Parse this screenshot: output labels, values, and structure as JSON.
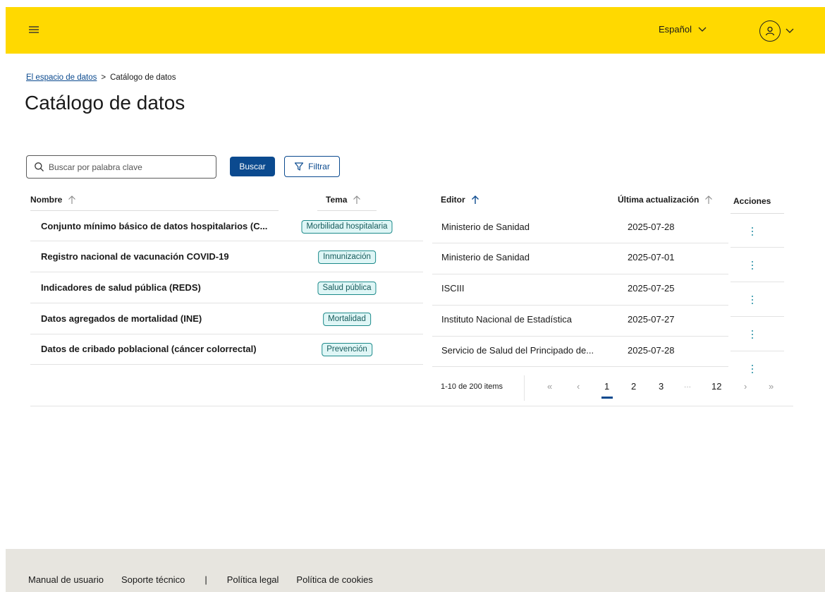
{
  "header": {
    "language": "Español",
    "menu_icon": "hamburger-menu-icon",
    "user_icon": "user-avatar-icon",
    "accent_color": "#ffd900"
  },
  "breadcrumb": {
    "parent": "El espacio de datos",
    "separator": ">",
    "current": "Catálogo de datos"
  },
  "page_title": "Catálogo de datos",
  "toolbar": {
    "search_placeholder": "Buscar por palabra clave",
    "search_button": "Buscar",
    "filter_button": "Filtrar",
    "primary_color": "#0b4a8f"
  },
  "table": {
    "columns": {
      "name": "Nombre",
      "theme": "Tema",
      "editor": "Editor",
      "updated": "Última actualización",
      "actions": "Acciones"
    },
    "rows": [
      {
        "name": "Conjunto mínimo básico de datos hospitalarios (C...",
        "theme": "Morbilidad hospitalaria",
        "editor": "Ministerio de Sanidad",
        "updated": "2025-07-28"
      },
      {
        "name": "Registro nacional de vacunación COVID-19",
        "theme": "Inmunización",
        "editor": "Ministerio de Sanidad",
        "updated": "2025-07-01"
      },
      {
        "name": "Indicadores de salud pública (REDS)",
        "theme": "Salud pública",
        "editor": "ISCIII",
        "updated": "2025-07-25"
      },
      {
        "name": "Datos agregados de mortalidad (INE)",
        "theme": "Mortalidad",
        "editor": "Instituto Nacional de Estadística",
        "updated": "2025-07-27"
      },
      {
        "name": "Datos de cribado poblacional (cáncer colorrectal)",
        "theme": "Prevención",
        "editor": "Servicio de Salud del Principado de...",
        "updated": "2025-07-28"
      }
    ]
  },
  "pagination": {
    "info": "1-10 de 200 items",
    "first": "«",
    "prev": "‹",
    "pages": [
      "1",
      "2",
      "3"
    ],
    "ellipsis": "···",
    "last_page": "12",
    "next": "›",
    "last": "»",
    "active_page": "1"
  },
  "footer": {
    "links": [
      "Manual de usuario",
      "Soporte técnico",
      "Política legal",
      "Política de cookies"
    ],
    "divider": "|",
    "background": "#e7e5df"
  }
}
